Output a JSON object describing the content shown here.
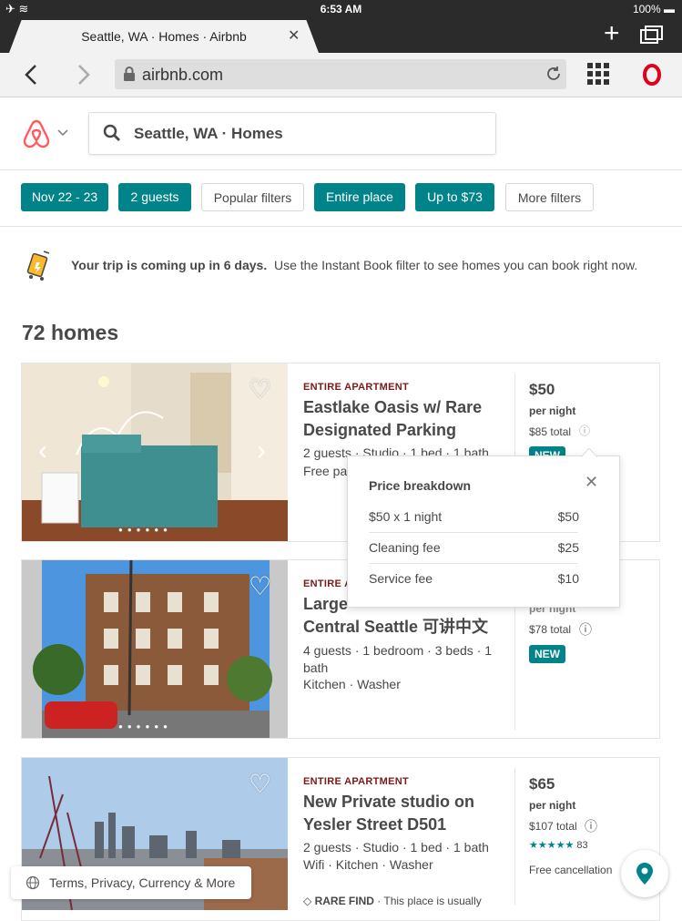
{
  "status": {
    "time": "6:53 AM",
    "battery": "100%"
  },
  "browser": {
    "tab_title": "Seattle, WA · Homes · Airbnb",
    "url": "airbnb.com"
  },
  "search": {
    "text": "Seattle, WA · Homes"
  },
  "filters": [
    {
      "label": "Nov 22 - 23",
      "active": true
    },
    {
      "label": "2 guests",
      "active": true
    },
    {
      "label": "Popular filters",
      "active": false
    },
    {
      "label": "Entire place",
      "active": true
    },
    {
      "label": "Up to $73",
      "active": true
    },
    {
      "label": "More filters",
      "active": false
    }
  ],
  "trip": {
    "bold": "Your trip is coming up in 6 days.",
    "rest": "Use the Instant Book filter to see homes you can book right now."
  },
  "results_count": "72 homes",
  "listings": [
    {
      "kind": "ENTIRE APARTMENT",
      "title": "Eastlake Oasis w/ Rare Designated Parking",
      "details": "2 guests · Studio · 1 bed · 1 bath",
      "amenities": "Free par",
      "price": "$50",
      "per": "per night",
      "total": "$85 total",
      "badge": "NEW"
    },
    {
      "kind": "ENTIRE A",
      "title_l1": "Large",
      "title_l2": "Central Seattle 可讲中文",
      "details": "4 guests · 1 bedroom · 3 beds · 1 bath",
      "amenities": "Kitchen · Washer",
      "per": "per night",
      "total": "$78 total",
      "badge": "NEW"
    },
    {
      "kind": "ENTIRE APARTMENT",
      "title": "New Private studio on Yesler Street D501",
      "details": "2 guests · Studio · 1 bed · 1 bath",
      "amenities": "Wifi · Kitchen · Washer",
      "price": "$65",
      "per": "per night",
      "total": "$107 total",
      "stars": "★★★★★",
      "reviews": "83",
      "cancellation": "Free cancellation",
      "rare_label": "RARE FIND",
      "rare_text": "· This place is usually"
    }
  ],
  "price_breakdown": {
    "heading": "Price breakdown",
    "rows": [
      {
        "label": "$50 x 1 night",
        "value": "$50"
      },
      {
        "label": "Cleaning fee",
        "value": "$25"
      },
      {
        "label": "Service fee",
        "value": "$10"
      }
    ]
  },
  "footer": {
    "terms": "Terms, Privacy, Currency & More"
  },
  "colors": {
    "teal": "#008489",
    "brand": "#FF5A5F",
    "kind": "#7b1a16"
  }
}
